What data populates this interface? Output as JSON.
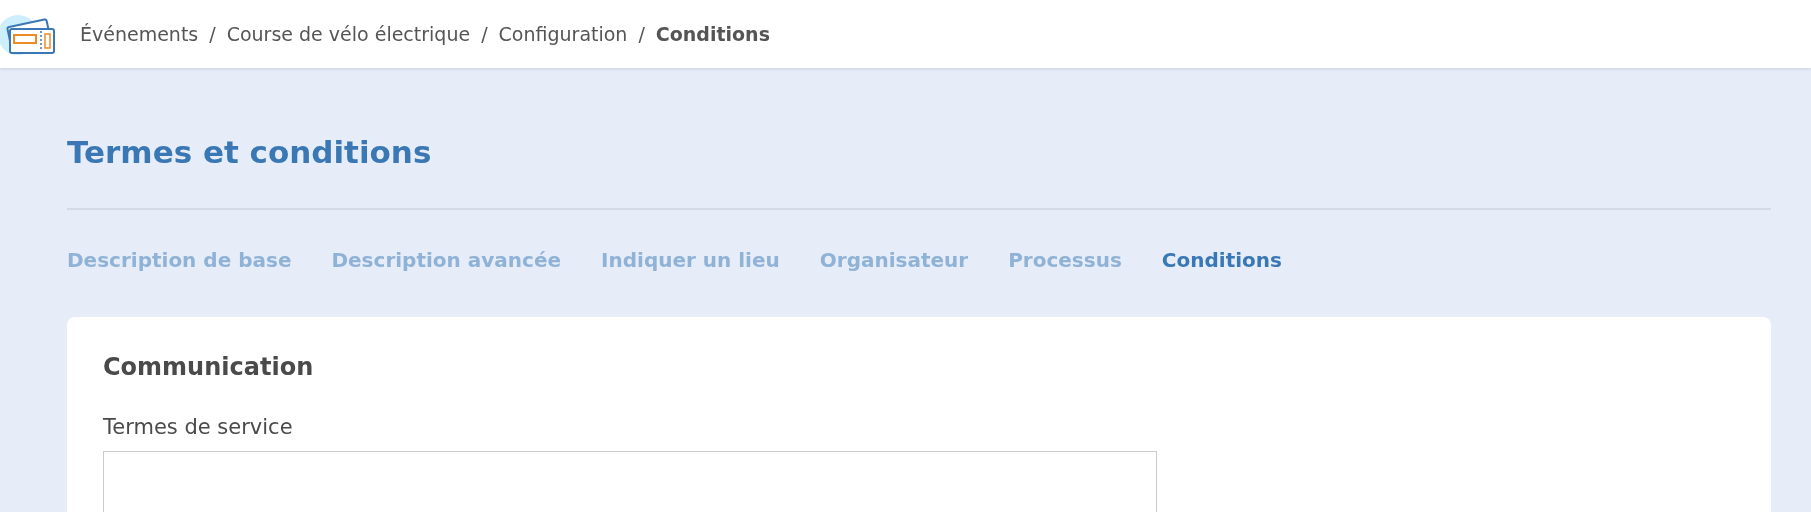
{
  "breadcrumb": [
    {
      "label": "Événements",
      "current": false
    },
    {
      "label": "Course de vélo électrique",
      "current": false
    },
    {
      "label": "Configuration",
      "current": false
    },
    {
      "label": "Conditions",
      "current": true
    }
  ],
  "breadcrumb_separator": "/",
  "page_title": "Termes et conditions",
  "tabs": [
    {
      "label": "Description de base",
      "selected": false
    },
    {
      "label": "Description avancée",
      "selected": false
    },
    {
      "label": "Indiquer un lieu",
      "selected": false
    },
    {
      "label": "Organisateur",
      "selected": false
    },
    {
      "label": "Processus",
      "selected": false
    },
    {
      "label": "Conditions",
      "selected": true
    }
  ],
  "card": {
    "title": "Communication",
    "field_label": "Termes de service"
  }
}
